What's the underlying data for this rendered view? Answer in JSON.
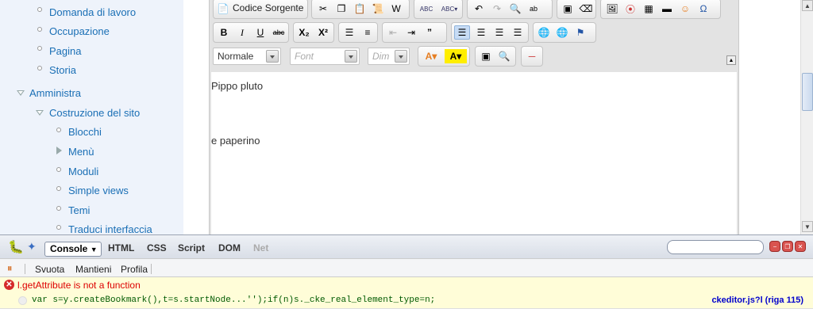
{
  "sidebar": {
    "items": [
      {
        "label": "Domanda di lavoro"
      },
      {
        "label": "Occupazione"
      },
      {
        "label": "Pagina"
      },
      {
        "label": "Storia"
      },
      {
        "label": "Amministra"
      },
      {
        "label": "Costruzione del sito"
      },
      {
        "label": "Blocchi"
      },
      {
        "label": "Menù"
      },
      {
        "label": "Moduli"
      },
      {
        "label": "Simple views"
      },
      {
        "label": "Temi"
      },
      {
        "label": "Traduci interfaccia"
      }
    ]
  },
  "editor": {
    "source_button": "Codice Sorgente",
    "format_combo": "Normale",
    "font_combo": "Font",
    "size_combo": "Dim",
    "content_lines": [
      "Pippo pluto",
      "e paperino"
    ]
  },
  "firebug": {
    "tabs": {
      "console": "Console",
      "html": "HTML",
      "css": "CSS",
      "script": "Script",
      "dom": "DOM",
      "net": "Net"
    },
    "toolbar": {
      "clear": "Svuota",
      "persist": "Mantieni",
      "profile": "Profila"
    },
    "error_message": "l.getAttribute is not a function",
    "source_line": "var s=y.createBookmark(),t=s.startNode...'');if(n)s._cke_real_element_type=n;",
    "source_link": "ckeditor.js?l (riga 115)"
  },
  "colors": {
    "link": "#1a6fb5",
    "sidebar_bg": "#eef3fb",
    "error": "#d00",
    "error_row_bg": "#fffdd8"
  }
}
